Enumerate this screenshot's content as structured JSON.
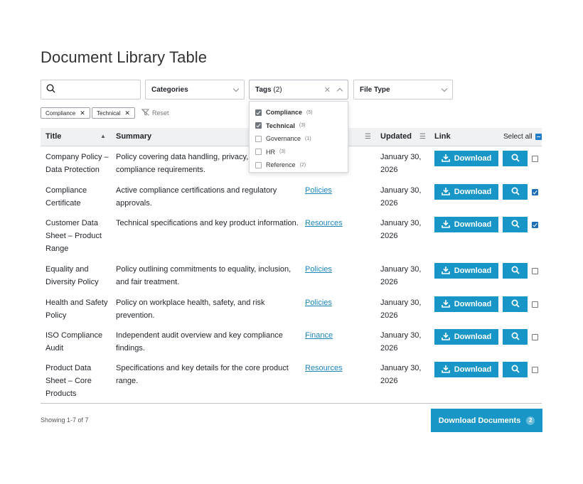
{
  "page": {
    "title": "Document Library Table"
  },
  "filters": {
    "search_placeholder": "",
    "categories_label": "Categories",
    "tags_label": "Tags",
    "tags_count": "(2)",
    "file_type_label": "File Type"
  },
  "chips": [
    {
      "label": "Compliance"
    },
    {
      "label": "Technical"
    }
  ],
  "reset_label": "Reset",
  "tags_dropdown": [
    {
      "name": "Compliance",
      "count": "(5)",
      "checked": true
    },
    {
      "name": "Technical",
      "count": "(3)",
      "checked": true
    },
    {
      "name": "Governance",
      "count": "(1)",
      "checked": false
    },
    {
      "name": "HR",
      "count": "(3)",
      "checked": false
    },
    {
      "name": "Reference",
      "count": "(2)",
      "checked": false
    }
  ],
  "table": {
    "headers": {
      "title": "Title",
      "summary": "Summary",
      "updated": "Updated",
      "link": "Link",
      "select_all": "Select all"
    },
    "download_label": "Download",
    "rows": [
      {
        "title": "Company Policy – Data Protection",
        "summary": "Policy covering data handling, privacy, and compliance requirements.",
        "category": "",
        "updated": "January 30, 2026",
        "checked": false
      },
      {
        "title": "Compliance Certificate",
        "summary": "Active compliance certifications and regulatory approvals.",
        "category": "Policies",
        "updated": "January 30, 2026",
        "checked": true
      },
      {
        "title": "Customer Data Sheet – Product Range",
        "summary": "Technical specifications and key product information.",
        "category": "Resources",
        "updated": "January 30, 2026",
        "checked": true
      },
      {
        "title": "Equality and Diversity Policy",
        "summary": "Policy outlining commitments to equality, inclusion, and fair treatment.",
        "category": "Policies",
        "updated": "January 30, 2026",
        "checked": false
      },
      {
        "title": "Health and Safety Policy",
        "summary": "Policy on workplace health, safety, and risk prevention.",
        "category": "Policies",
        "updated": "January 30, 2026",
        "checked": false
      },
      {
        "title": "ISO Compliance Audit",
        "summary": "Independent audit overview and key compliance findings.",
        "category": "Finance",
        "updated": "January 30, 2026",
        "checked": false
      },
      {
        "title": "Product Data Sheet – Core Products",
        "summary": "Specifications and key details for the core product range.",
        "category": "Resources",
        "updated": "January 30, 2026",
        "checked": false
      }
    ]
  },
  "footer": {
    "showing": "Showing 1-7 of 7",
    "download_documents_label": "Download Documents",
    "selected_count": "2"
  },
  "colors": {
    "accent": "#1796c7",
    "link": "#1b85b8",
    "checkbox": "#1e6fb8"
  }
}
